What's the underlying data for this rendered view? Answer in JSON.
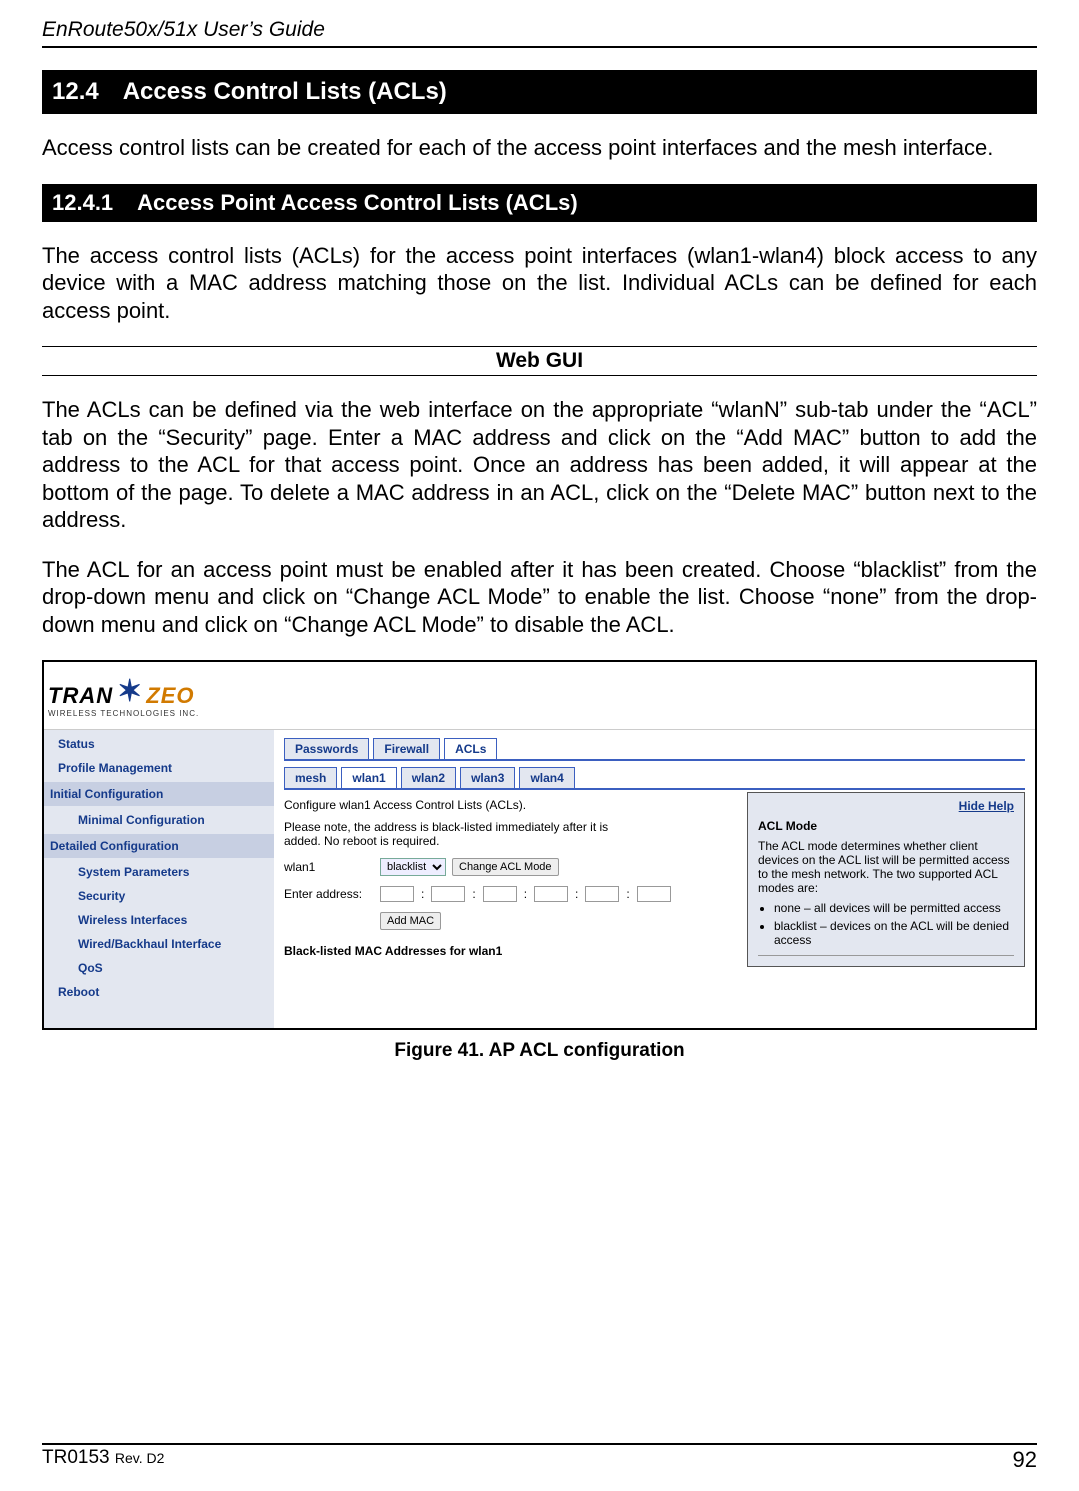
{
  "doc": {
    "header": "EnRoute50x/51x User’s Guide",
    "footer_left": "TR0153 ",
    "footer_left_small": "Rev. D2",
    "page_no": "92"
  },
  "sec": {
    "h124_num": "12.4",
    "h124_title": "Access Control Lists (ACLs)",
    "p124": "Access control lists can be created for each of the access point interfaces and the mesh interface.",
    "h1241_num": "12.4.1",
    "h1241_title": "Access Point Access Control Lists (ACLs)",
    "p1241": "The access control lists (ACLs) for the access point interfaces (wlan1-wlan4) block access to any device with a MAC address matching those on the list. Individual ACLs can be defined for each access point.",
    "webgui": "Web GUI",
    "p_webgui1": "The ACLs can be defined via the web interface on the appropriate “wlanN” sub-tab under the “ACL” tab on the “Security” page. Enter a MAC address and click on the “Add MAC” button to add the address to the ACL for that access point. Once an address has been added, it will appear at the bottom of the page. To delete a MAC address in an ACL, click on the “Delete MAC” button next to the address.",
    "p_webgui2": "The ACL for an access point must be enabled after it has been created. Choose “blacklist” from the drop-down menu and click on “Change ACL Mode” to enable the list. Choose “none” from the drop-down menu and click on “Change ACL Mode” to disable the ACL.",
    "figcap": "Figure 41. AP ACL configuration"
  },
  "shot": {
    "logo_main_a": "TRAN",
    "logo_main_b": "ZEO",
    "logo_sub": "WIRELESS TECHNOLOGIES INC.",
    "sidebar": {
      "status": "Status",
      "profile": "Profile Management",
      "initcfg": "Initial Configuration",
      "mincfg": "Minimal Configuration",
      "detcfg": "Detailed Configuration",
      "sysparam": "System Parameters",
      "security": "Security",
      "wifaces": "Wireless Interfaces",
      "wired": "Wired/Backhaul Interface",
      "qos": "QoS",
      "reboot": "Reboot"
    },
    "tabs1": {
      "passwords": "Passwords",
      "firewall": "Firewall",
      "acls": "ACLs"
    },
    "tabs2": {
      "mesh": "mesh",
      "wlan1": "wlan1",
      "wlan2": "wlan2",
      "wlan3": "wlan3",
      "wlan4": "wlan4"
    },
    "sub1": "Configure wlan1 Access Control Lists (ACLs).",
    "sub2": "Please note, the address is black-listed immediately after it is added. No reboot is required.",
    "row_label": "wlan1",
    "sel_value": "blacklist",
    "btn_change": "Change ACL Mode",
    "enter_addr": "Enter address:",
    "btn_addmac": "Add MAC",
    "blh": "Black-listed MAC Addresses for wlan1",
    "help": {
      "hide": "Hide Help",
      "title": "ACL Mode",
      "body": "The ACL mode determines whether client devices on the ACL list will be permitted access to the mesh network. The two supported ACL modes are:",
      "li1": "none – all devices will be permitted access",
      "li2": "blacklist – devices on the ACL will be denied access"
    }
  }
}
